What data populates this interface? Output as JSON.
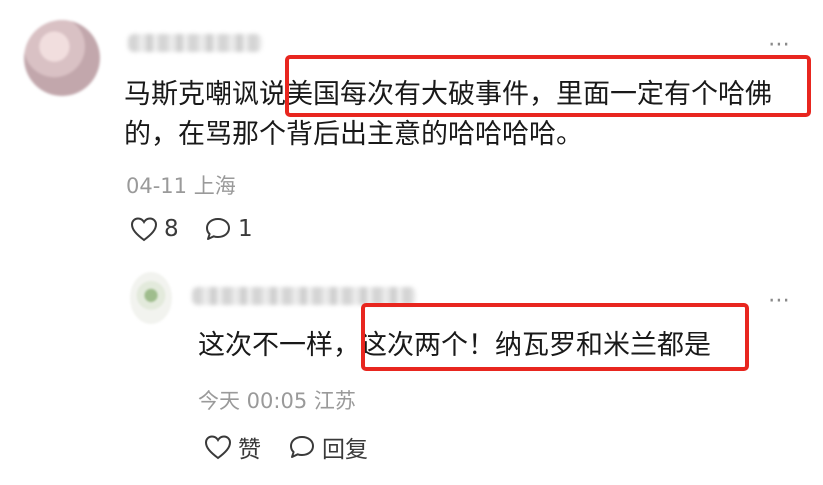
{
  "comment": {
    "text_line1": "马斯克嘲讽说美国每次有大破事件，里面一定有个哈佛",
    "text_line2": "的，在骂那个背后出主意的哈哈哈哈。",
    "date": "04-11",
    "location": "上海",
    "likes": "8",
    "replies": "1",
    "more_icon": "⋯"
  },
  "reply": {
    "text": "这次不一样，这次两个！纳瓦罗和米兰都是",
    "time": "今天 00:05",
    "location": "江苏",
    "like_label": "赞",
    "reply_label": "回复",
    "more_icon": "⋯"
  },
  "colors": {
    "highlight": "#e8261f",
    "meta_text": "#9a9a9a"
  }
}
